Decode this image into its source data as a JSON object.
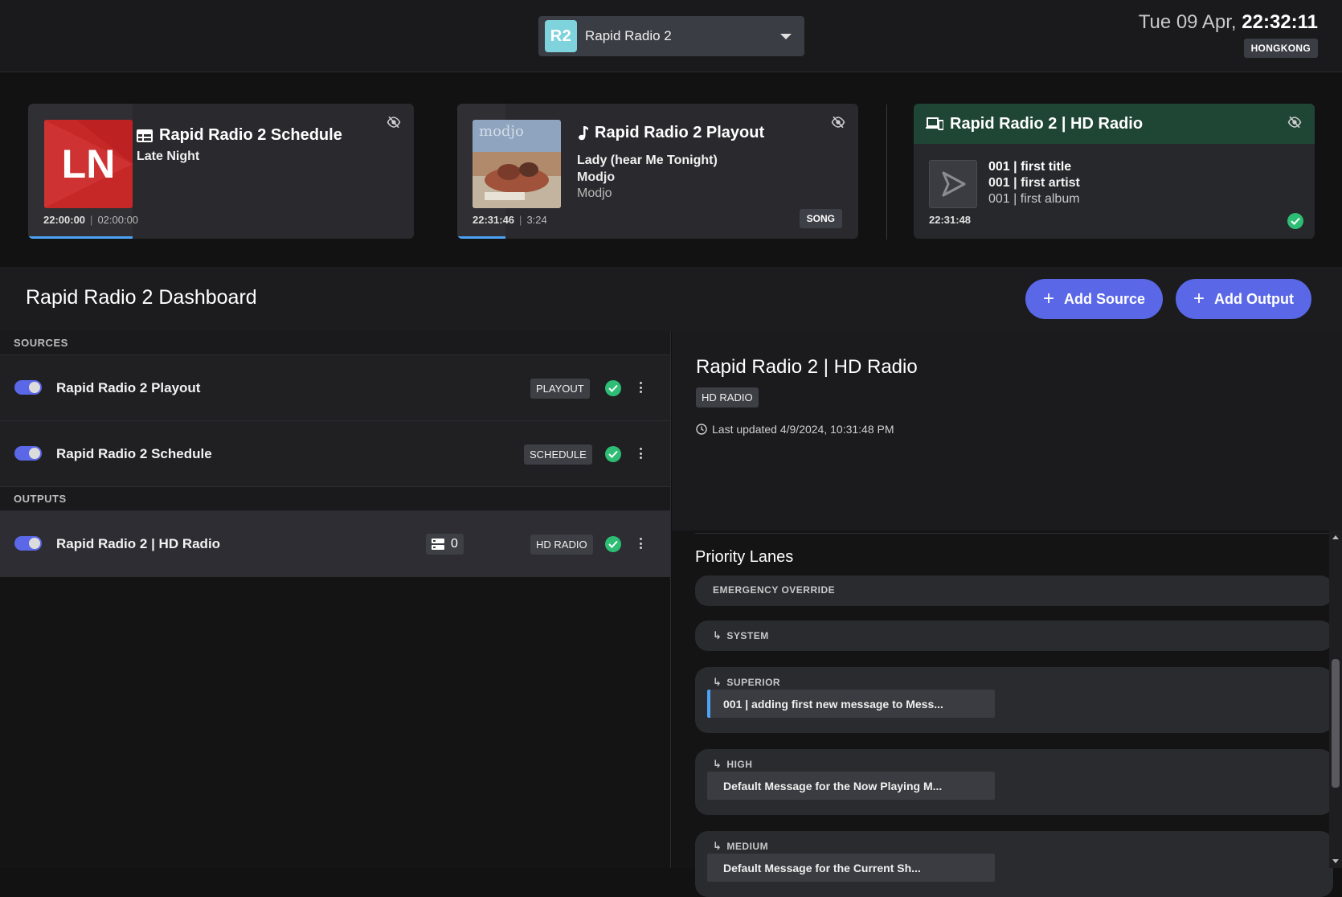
{
  "header": {
    "station": {
      "badge": "R2",
      "name": "Rapid Radio 2"
    },
    "clock": {
      "date": "Tue 09 Apr,",
      "time": "22:32:11",
      "timezone": "HONGKONG"
    }
  },
  "cards": {
    "schedule": {
      "title": "Rapid Radio 2 Schedule",
      "subtitle": "Late Night",
      "art_text": "LN",
      "start": "22:00:00",
      "duration": "02:00:00",
      "progress": 0.27
    },
    "playout": {
      "title": "Rapid Radio 2 Playout",
      "track": "Lady (hear Me Tonight)",
      "artist": "Modjo",
      "album": "Modjo",
      "art_text": "modjo",
      "start": "22:31:46",
      "duration": "3:24",
      "badge": "SONG",
      "progress": 0.12
    },
    "hd": {
      "title": "Rapid Radio 2 | HD Radio",
      "line1": "001 | first title",
      "line2": "001 | first artist",
      "line3": "001 | first album",
      "time": "22:31:48"
    }
  },
  "dashboard": {
    "title": "Rapid Radio 2 Dashboard",
    "add_source": "Add Source",
    "add_output": "Add Output"
  },
  "sources": {
    "label": "SOURCES",
    "items": [
      {
        "name": "Rapid Radio 2 Playout",
        "tag": "PLAYOUT"
      },
      {
        "name": "Rapid Radio 2 Schedule",
        "tag": "SCHEDULE"
      }
    ]
  },
  "outputs": {
    "label": "OUTPUTS",
    "items": [
      {
        "name": "Rapid Radio 2 | HD Radio",
        "tag": "HD RADIO",
        "queue": "0"
      }
    ]
  },
  "detail": {
    "title": "Rapid Radio 2 | HD Radio",
    "tag": "HD RADIO",
    "last_updated": "Last updated 4/9/2024, 10:31:48 PM"
  },
  "priority_lanes": {
    "title": "Priority Lanes",
    "lanes": [
      {
        "label": "EMERGENCY OVERRIDE"
      },
      {
        "label": "SYSTEM"
      },
      {
        "label": "SUPERIOR",
        "item": "001 | adding first new message to Mess..."
      },
      {
        "label": "HIGH",
        "item": "Default Message for the Now Playing M..."
      },
      {
        "label": "MEDIUM",
        "item": "Default Message for the Current Sh..."
      }
    ]
  },
  "colors": {
    "accent": "#5a68e8",
    "progress": "#4da3f5",
    "success": "#2ebd74",
    "hd_header": "#1f4534",
    "schedule_art": "#c62828"
  }
}
